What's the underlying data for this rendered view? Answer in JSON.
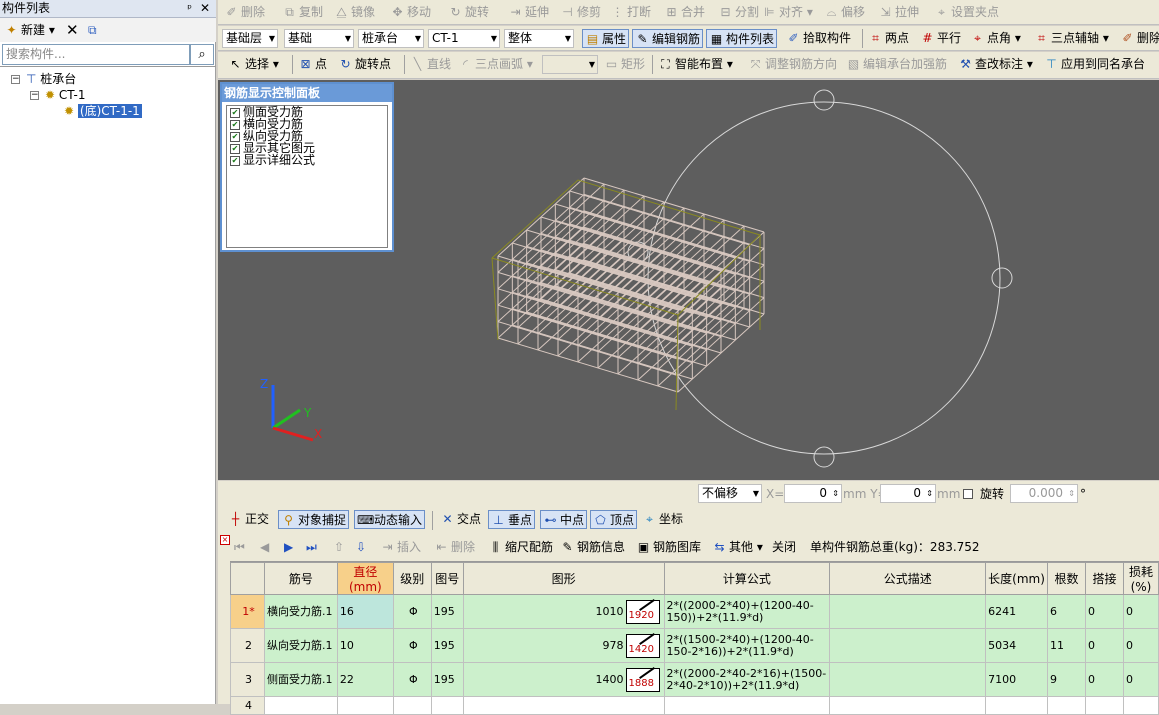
{
  "left_panel": {
    "title": "构件列表",
    "pin": "ᵖ",
    "close": "✕",
    "new_label": "新建",
    "search_placeholder": "搜索构件...",
    "tree": {
      "root": "桩承台",
      "child": "CT-1",
      "leaf": "(底)CT-1-1"
    }
  },
  "toolbar1": {
    "items": [
      "删除",
      "复制",
      "镜像",
      "移动",
      "旋转",
      "延伸",
      "修剪",
      "打断",
      "合并",
      "分割",
      "对齐",
      "偏移",
      "拉伸",
      "设置夹点"
    ]
  },
  "toolbar2": {
    "floor": "基础层",
    "category": "基础",
    "type": "桩承台",
    "component": "CT-1",
    "scope": "整体",
    "buttons": [
      "属性",
      "编辑钢筋",
      "构件列表",
      "拾取构件",
      "两点",
      "平行",
      "点角",
      "三点辅轴",
      "删除"
    ]
  },
  "toolbar3": {
    "items": [
      "选择",
      "点",
      "旋转点",
      "直线",
      "三点画弧",
      "矩形",
      "智能布置",
      "调整钢筋方向",
      "编辑承台加强筋",
      "查改标注",
      "应用到同名承台"
    ]
  },
  "rebar_panel": {
    "title": "钢筋显示控制面板",
    "options": [
      "侧面受力筋",
      "横向受力筋",
      "纵向受力筋",
      "显示其它图元",
      "显示详细公式"
    ]
  },
  "statusbar": {
    "offset_mode": "不偏移",
    "x_label": "X=",
    "x_value": "0",
    "y_label": "mm Y=",
    "y_value": "0",
    "mm": "mm",
    "rotate_label": "旋转",
    "rotate_value": "0.000",
    "degree": "°"
  },
  "snapbar": {
    "items": [
      "正交",
      "对象捕捉",
      "动态输入",
      "交点",
      "垂点",
      "中点",
      "顶点",
      "坐标"
    ]
  },
  "bottom_toolbar": {
    "insert": "插入",
    "delete": "删除",
    "scale_rebar": "缩尺配筋",
    "rebar_info": "钢筋信息",
    "rebar_lib": "钢筋图库",
    "other": "其他",
    "close": "关闭",
    "total_weight": "单构件钢筋总重(kg)：283.752"
  },
  "grid": {
    "headers": [
      "筋号",
      "直径(mm)",
      "级别",
      "图号",
      "图形",
      "计算公式",
      "公式描述",
      "长度(mm)",
      "根数",
      "搭接",
      "损耗(%)"
    ],
    "rows": [
      {
        "no": "1*",
        "name": "横向受力筋.1",
        "dia": "16",
        "grade": "Φ",
        "fig": "195",
        "len1": "1010",
        "shape_val": "1920",
        "formula": "2*((2000-2*40)+(1200-40-150))+2*(11.9*d)",
        "desc": "",
        "length": "6241",
        "count": "6",
        "lap": "0",
        "loss": "0"
      },
      {
        "no": "2",
        "name": "纵向受力筋.1",
        "dia": "10",
        "grade": "Φ",
        "fig": "195",
        "len1": "978",
        "shape_val": "1420",
        "formula": "2*((1500-2*40)+(1200-40-150-2*16))+2*(11.9*d)",
        "desc": "",
        "length": "5034",
        "count": "11",
        "lap": "0",
        "loss": "0"
      },
      {
        "no": "3",
        "name": "侧面受力筋.1",
        "dia": "22",
        "grade": "Φ",
        "fig": "195",
        "len1": "1400",
        "shape_val": "1888",
        "formula": "2*((2000-2*40-2*16)+(1500-2*40-2*10))+2*(11.9*d)",
        "desc": "",
        "length": "7100",
        "count": "9",
        "lap": "0",
        "loss": "0"
      }
    ],
    "empty_row": "4"
  },
  "axis": {
    "x": "X",
    "y": "Y",
    "z": "Z"
  },
  "colors": {
    "viewport_bg": "#5e5e5e",
    "row_bg": "#ccf0cc",
    "panel_title": "#6a9ad8",
    "axis_x": "#e02020",
    "axis_y": "#20c020",
    "axis_z": "#2060ff"
  }
}
